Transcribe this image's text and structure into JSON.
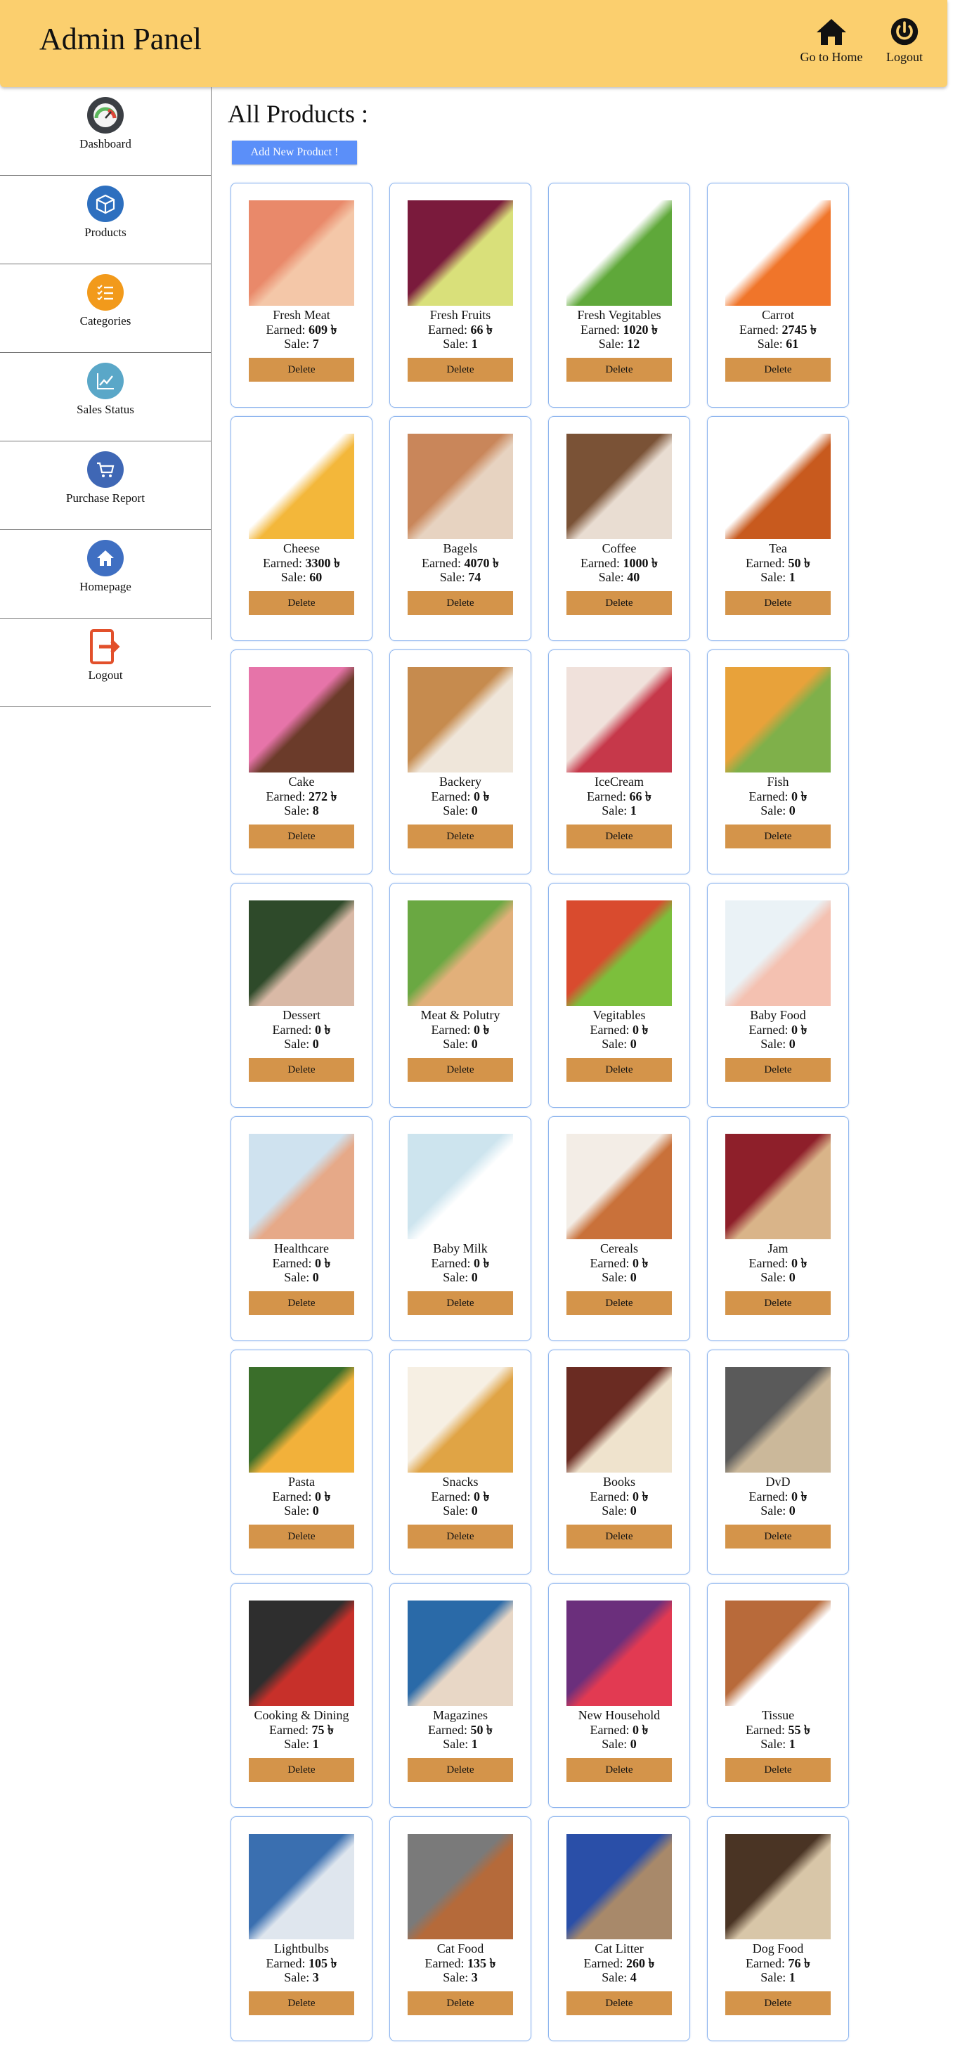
{
  "header": {
    "title": "Admin Panel",
    "home_label": "Go to Home",
    "logout_label": "Logout"
  },
  "sidebar": {
    "items": [
      {
        "label": "Dashboard",
        "icon": "gauge-icon"
      },
      {
        "label": "Products",
        "icon": "box-icon"
      },
      {
        "label": "Categories",
        "icon": "list-icon"
      },
      {
        "label": "Sales Status",
        "icon": "chart-icon"
      },
      {
        "label": "Purchase Report",
        "icon": "cart-icon"
      },
      {
        "label": "Homepage",
        "icon": "home-icon"
      },
      {
        "label": "Logout",
        "icon": "exit-icon"
      }
    ]
  },
  "main": {
    "title": "All Products :",
    "add_button": "Add New Product !",
    "earned_label": "Earned:",
    "sale_label": "Sale:",
    "currency": "৳",
    "delete_label": "Delete"
  },
  "products": [
    {
      "name": "Fresh Meat",
      "earned": "609",
      "sale": "7",
      "c1": "#e9896a",
      "c2": "#f4c7a8"
    },
    {
      "name": "Fresh Fruits",
      "earned": "66",
      "sale": "1",
      "c1": "#7a1a3c",
      "c2": "#d9e07a"
    },
    {
      "name": "Fresh Vegitables",
      "earned": "1020",
      "sale": "12",
      "c1": "#ffffff",
      "c2": "#5fa83a"
    },
    {
      "name": "Carrot",
      "earned": "2745",
      "sale": "61",
      "c1": "#ffffff",
      "c2": "#f0752a"
    },
    {
      "name": "Cheese",
      "earned": "3300",
      "sale": "60",
      "c1": "#ffffff",
      "c2": "#f3b73a"
    },
    {
      "name": "Bagels",
      "earned": "4070",
      "sale": "74",
      "c1": "#c9865a",
      "c2": "#e7d3c1"
    },
    {
      "name": "Coffee",
      "earned": "1000",
      "sale": "40",
      "c1": "#7a5236",
      "c2": "#e9ddd2"
    },
    {
      "name": "Tea",
      "earned": "50",
      "sale": "1",
      "c1": "#ffffff",
      "c2": "#c85a1e"
    },
    {
      "name": "Cake",
      "earned": "272",
      "sale": "8",
      "c1": "#e674a9",
      "c2": "#6b3b2a"
    },
    {
      "name": "Backery",
      "earned": "0",
      "sale": "0",
      "c1": "#c68b4e",
      "c2": "#efe6da"
    },
    {
      "name": "IceCream",
      "earned": "66",
      "sale": "1",
      "c1": "#f0e1db",
      "c2": "#c6384a"
    },
    {
      "name": "Fish",
      "earned": "0",
      "sale": "0",
      "c1": "#e8a23a",
      "c2": "#7fb04a"
    },
    {
      "name": "Dessert",
      "earned": "0",
      "sale": "0",
      "c1": "#2e4a2a",
      "c2": "#d9b9a6"
    },
    {
      "name": "Meat & Polutry",
      "earned": "0",
      "sale": "0",
      "c1": "#6aa842",
      "c2": "#e2b07a"
    },
    {
      "name": "Vegitables",
      "earned": "0",
      "sale": "0",
      "c1": "#d94b2e",
      "c2": "#7cbf3c"
    },
    {
      "name": "Baby Food",
      "earned": "0",
      "sale": "0",
      "c1": "#eaf2f6",
      "c2": "#f4c1b1"
    },
    {
      "name": "Healthcare",
      "earned": "0",
      "sale": "0",
      "c1": "#cfe2ef",
      "c2": "#e6a988"
    },
    {
      "name": "Baby Milk",
      "earned": "0",
      "sale": "0",
      "c1": "#cde4ee",
      "c2": "#ffffff"
    },
    {
      "name": "Cereals",
      "earned": "0",
      "sale": "0",
      "c1": "#f3ede6",
      "c2": "#c9713a"
    },
    {
      "name": "Jam",
      "earned": "0",
      "sale": "0",
      "c1": "#8e1f2a",
      "c2": "#d9b489"
    },
    {
      "name": "Pasta",
      "earned": "0",
      "sale": "0",
      "c1": "#3a6e2a",
      "c2": "#f2b13a"
    },
    {
      "name": "Snacks",
      "earned": "0",
      "sale": "0",
      "c1": "#f6efe3",
      "c2": "#e0a445"
    },
    {
      "name": "Books",
      "earned": "0",
      "sale": "0",
      "c1": "#6a2b22",
      "c2": "#efe3cd"
    },
    {
      "name": "DvD",
      "earned": "0",
      "sale": "0",
      "c1": "#5a5a5a",
      "c2": "#cbb89a"
    },
    {
      "name": "Cooking & Dining",
      "earned": "75",
      "sale": "1",
      "c1": "#2e2e2e",
      "c2": "#c7302a"
    },
    {
      "name": "Magazines",
      "earned": "50",
      "sale": "1",
      "c1": "#2a6aa8",
      "c2": "#e8d7c6"
    },
    {
      "name": "New Household",
      "earned": "0",
      "sale": "0",
      "c1": "#6b2f7c",
      "c2": "#e23a52"
    },
    {
      "name": "Tissue",
      "earned": "55",
      "sale": "1",
      "c1": "#b86a3a",
      "c2": "#ffffff"
    },
    {
      "name": "Lightbulbs",
      "earned": "105",
      "sale": "3",
      "c1": "#3a6fb0",
      "c2": "#dfe6ee"
    },
    {
      "name": "Cat Food",
      "earned": "135",
      "sale": "3",
      "c1": "#7a7a7a",
      "c2": "#b56a3a"
    },
    {
      "name": "Cat Litter",
      "earned": "260",
      "sale": "4",
      "c1": "#2a4fa8",
      "c2": "#a8896a"
    },
    {
      "name": "Dog Food",
      "earned": "76",
      "sale": "1",
      "c1": "#4a3424",
      "c2": "#d8c6a8"
    }
  ],
  "colors": {
    "header_bg": "#fbcf6e",
    "add_button_bg": "#5b8ff9",
    "delete_button_bg": "#d4944a",
    "card_border": "#8cb4ee"
  }
}
